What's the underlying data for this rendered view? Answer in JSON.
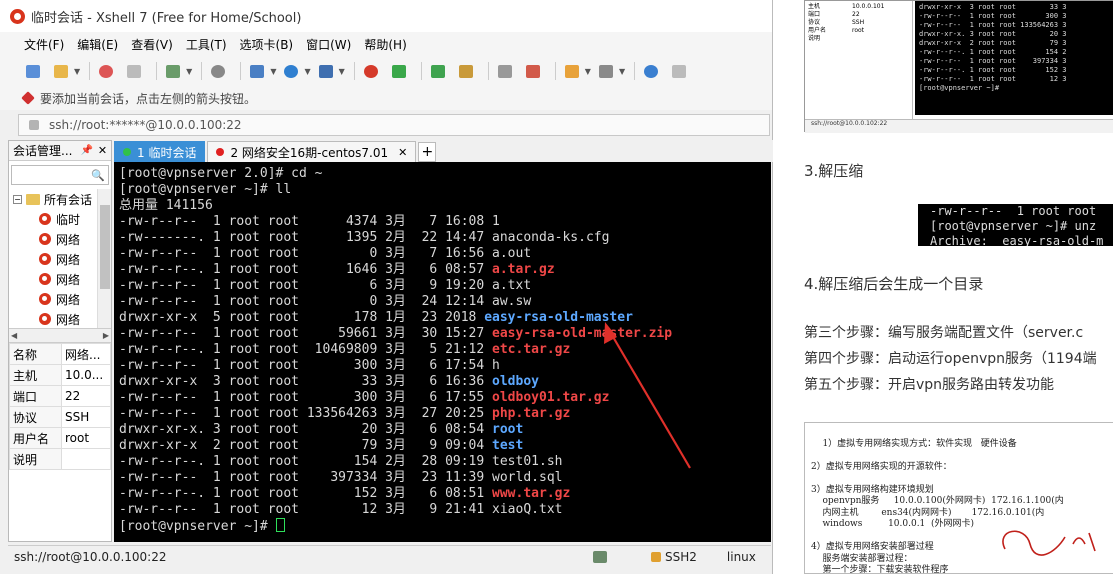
{
  "window": {
    "title": "临时会话 - Xshell 7 (Free for Home/School)"
  },
  "menu": [
    "文件(F)",
    "编辑(E)",
    "查看(V)",
    "工具(T)",
    "选项卡(B)",
    "窗口(W)",
    "帮助(H)"
  ],
  "hint": "要添加当前会话，点击左侧的箭头按钮。",
  "address": "ssh://root:******@10.0.0.100:22",
  "session_panel": {
    "title": "会话管理...",
    "tree_root": "所有会话",
    "tree_items": [
      "临时",
      "网络",
      "网络",
      "网络",
      "网络",
      "网络"
    ],
    "properties": [
      {
        "k": "名称",
        "v": "网络..."
      },
      {
        "k": "主机",
        "v": "10.0..."
      },
      {
        "k": "端口",
        "v": "22"
      },
      {
        "k": "协议",
        "v": "SSH"
      },
      {
        "k": "用户名",
        "v": "root"
      },
      {
        "k": "说明",
        "v": ""
      }
    ]
  },
  "tabs": [
    {
      "label": "1 临时会话",
      "dot": "#31c14a",
      "active": true
    },
    {
      "label": "2 网络安全16期-centos7.01",
      "dot": "#e02020",
      "active": false
    }
  ],
  "terminal": {
    "lines": [
      [
        {
          "t": "[root@vpnserver 2.0]# cd ~"
        }
      ],
      [
        {
          "t": "[root@vpnserver ~]# ll"
        }
      ],
      [
        {
          "t": "总用量 141156"
        }
      ],
      [
        {
          "t": "-rw-r--r--  1 root root      4374 3月   7 16:08 1"
        }
      ],
      [
        {
          "t": "-rw-------. 1 root root      1395 2月  22 14:47 anaconda-ks.cfg"
        }
      ],
      [
        {
          "t": "-rw-r--r--  1 root root         0 3月   7 16:56 a.out"
        }
      ],
      [
        {
          "t": "-rw-r--r--. 1 root root      1646 3月   6 08:57 "
        },
        {
          "t": "a.tar.gz",
          "c": "red"
        }
      ],
      [
        {
          "t": "-rw-r--r--  1 root root         6 3月   9 19:20 a.txt"
        }
      ],
      [
        {
          "t": "-rw-r--r--  1 root root         0 3月  24 12:14 aw.sw"
        }
      ],
      [
        {
          "t": "drwxr-xr-x  5 root root       178 1月  23 2018 "
        },
        {
          "t": "easy-rsa-old-master",
          "c": "blue"
        }
      ],
      [
        {
          "t": "-rw-r--r--  1 root root     59661 3月  30 15:27 "
        },
        {
          "t": "easy-rsa-old-master.zip",
          "c": "red"
        }
      ],
      [
        {
          "t": "-rw-r--r--. 1 root root  10469809 3月   5 21:12 "
        },
        {
          "t": "etc.tar.gz",
          "c": "red"
        }
      ],
      [
        {
          "t": "-rw-r--r--  1 root root       300 3月   6 17:54 h"
        }
      ],
      [
        {
          "t": "drwxr-xr-x  3 root root        33 3月   6 16:36 "
        },
        {
          "t": "oldboy",
          "c": "blue"
        }
      ],
      [
        {
          "t": "-rw-r--r--  1 root root       300 3月   6 17:55 "
        },
        {
          "t": "oldboy01.tar.gz",
          "c": "red"
        }
      ],
      [
        {
          "t": "-rw-r--r--  1 root root 133564263 3月  27 20:25 "
        },
        {
          "t": "php.tar.gz",
          "c": "red"
        }
      ],
      [
        {
          "t": "drwxr-xr-x. 3 root root        20 3月   6 08:54 "
        },
        {
          "t": "root",
          "c": "blue"
        }
      ],
      [
        {
          "t": "drwxr-xr-x  2 root root        79 3月   9 09:04 "
        },
        {
          "t": "test",
          "c": "blue"
        }
      ],
      [
        {
          "t": "-rw-r--r--. 1 root root       154 2月  28 09:19 test01.sh"
        }
      ],
      [
        {
          "t": "-rw-r--r--  1 root root    397334 3月  23 11:39 world.sql"
        }
      ],
      [
        {
          "t": "-rw-r--r--. 1 root root       152 3月   6 08:51 "
        },
        {
          "t": "www.tar.gz",
          "c": "red"
        }
      ],
      [
        {
          "t": "-rw-r--r--  1 root root        12 3月   9 21:41 xiaoQ.txt"
        }
      ],
      [
        {
          "t": "[root@vpnserver ~]# "
        },
        {
          "cursor": true
        }
      ]
    ]
  },
  "statusbar": {
    "path": "ssh://root@10.0.0.100:22",
    "protocol": "SSH2",
    "os": "linux"
  },
  "doc": {
    "shot_top_props": [
      {
        "k": "主机",
        "v": "10.0.0.101"
      },
      {
        "k": "端口",
        "v": "22"
      },
      {
        "k": "协议",
        "v": "SSH"
      },
      {
        "k": "用户名",
        "v": "root"
      },
      {
        "k": "说明",
        "v": ""
      }
    ],
    "shot_top_terminal": "drwxr-xr-x  3 root root        33 3\n-rw-r--r--  1 root root       300 3\n-rw-r--r--  1 root root 133564263 3\ndrwxr-xr-x. 3 root root        20 3\ndrwxr-xr-x  2 root root        79 3\n-rw-r--r--. 1 root root       154 2\n-rw-r--r--  1 root root    397334 3\n-rw-r--r--. 1 root root       152 3\n-rw-r--r--  1 root root        12 3\n[root@vpnserver ~]#",
    "shot_top_status": "ssh://root@10.0.0.102:22",
    "heading_3": "3.解压缩",
    "shot_mid": "-rw-r--r--  1 root root\n[root@vpnserver ~]# unz\nArchive:  easy-rsa-old-m",
    "heading_4": "4.解压缩后会生成一个目录",
    "steps": [
      "第三个步骤：编写服务端配置文件（server.c",
      "第四个步骤：启动运行openvpn服务（1194端",
      "第五个步骤：开启vpn服务路由转发功能"
    ],
    "shot_bottom": "1）虚拟专用网络实现方式：软件实现   硬件设备\n\n2）虚拟专用网络实现的开源软件：\n\n3）虚拟专用网络构建环境规划\n    openvpn服务     10.0.0.100(外网网卡)  172.16.1.100(内\n    内网主机        ens34(内网网卡)       172.16.0.101(内\n    windows         10.0.0.1  (外网网卡)\n\n4）虚拟专用网络安装部署过程\n    服务端安装部署过程：\n    第一个步骤：下载安装软件程序\n    第二个步骤：创建秘钥文件信息（私钥文件 公钥文件-证书"
  }
}
